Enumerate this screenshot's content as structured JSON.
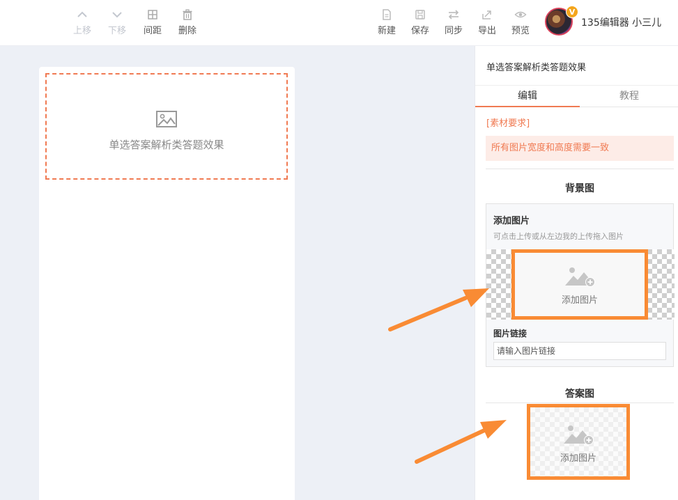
{
  "toolbar": {
    "left": [
      {
        "label": "上移",
        "icon": "chevron-up-icon",
        "enabled": false
      },
      {
        "label": "下移",
        "icon": "chevron-down-icon",
        "enabled": false
      },
      {
        "label": "间距",
        "icon": "grid-icon",
        "enabled": true
      },
      {
        "label": "删除",
        "icon": "trash-icon",
        "enabled": true
      }
    ],
    "right": [
      {
        "label": "新建",
        "icon": "new-document-icon"
      },
      {
        "label": "保存",
        "icon": "save-icon"
      },
      {
        "label": "同步",
        "icon": "sync-icon"
      },
      {
        "label": "导出",
        "icon": "export-icon"
      },
      {
        "label": "预览",
        "icon": "eye-icon"
      }
    ]
  },
  "user": {
    "name": "135编辑器 小三儿",
    "badge": "V"
  },
  "canvas": {
    "placeholder_text": "单选答案解析类答题效果",
    "placeholder_border_color": "#f07a52"
  },
  "panel": {
    "title": "单选答案解析类答题效果",
    "tabs": [
      {
        "label": "编辑",
        "active": true
      },
      {
        "label": "教程",
        "active": false
      }
    ],
    "requirement_label": "[素材要求]",
    "notice": "所有图片宽度和高度需要一致",
    "background": {
      "section_title": "背景图",
      "box_title": "添加图片",
      "box_hint": "可点击上传或从左边我的上传拖入图片",
      "add_label": "添加图片",
      "link_label": "图片链接",
      "link_placeholder": "请输入图片链接"
    },
    "answer": {
      "section_title": "答案图",
      "add_label": "添加图片"
    }
  },
  "colors": {
    "accent": "#f07a52",
    "highlight": "#f98b34",
    "canvas_bg": "#edf0f6"
  }
}
